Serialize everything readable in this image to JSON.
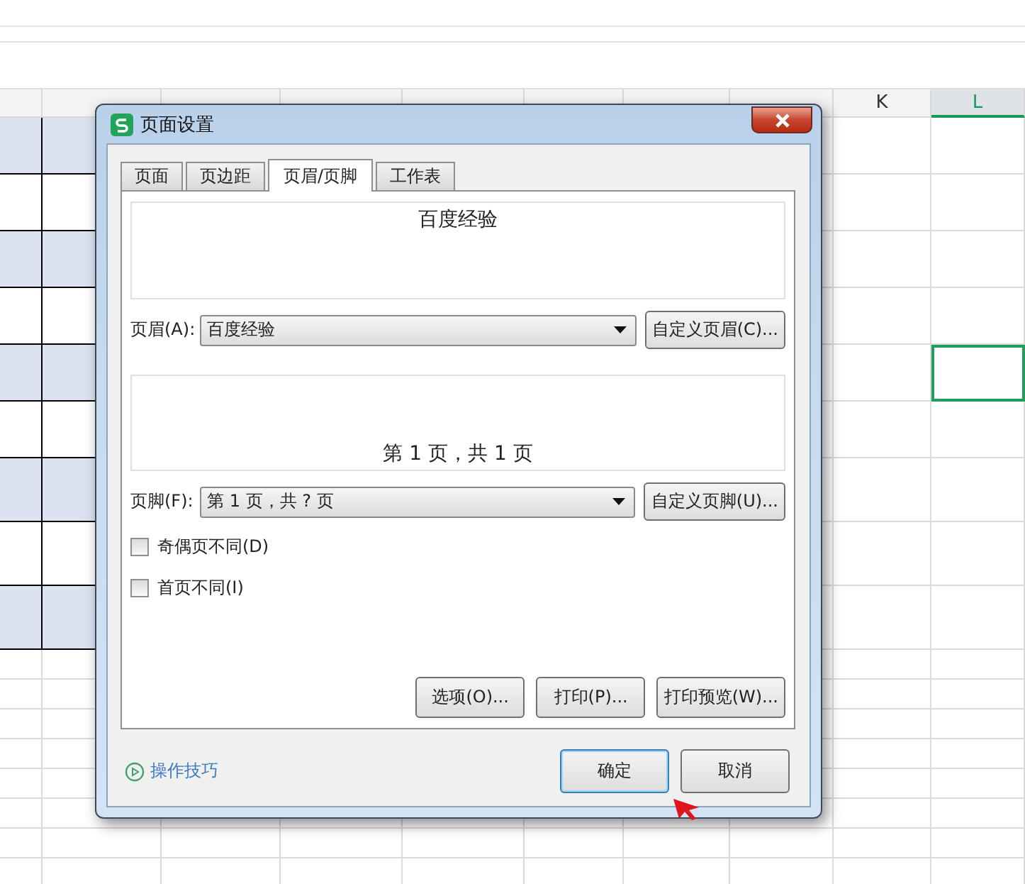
{
  "sheet": {
    "columns": [
      {
        "label": "K",
        "selected": false
      },
      {
        "label": "L",
        "selected": true
      }
    ]
  },
  "dialog": {
    "title": "页面设置",
    "tabs": [
      {
        "label": "页面",
        "selected": false
      },
      {
        "label": "页边距",
        "selected": false
      },
      {
        "label": "页眉/页脚",
        "selected": true
      },
      {
        "label": "工作表",
        "selected": false
      }
    ],
    "header_preview": "百度经验",
    "header": {
      "label": "页眉(A):",
      "value": "百度经验",
      "button": "自定义页眉(C)..."
    },
    "footer_preview": "第 1 页，共 1 页",
    "footer": {
      "label": "页脚(F):",
      "value": "第 1 页，共 ? 页",
      "button": "自定义页脚(U)..."
    },
    "checkboxes": [
      {
        "label": "奇偶页不同(D)",
        "checked": false
      },
      {
        "label": "首页不同(I)",
        "checked": false
      }
    ],
    "buttons": [
      "选项(O)...",
      "打印(P)...",
      "打印预览(W)..."
    ],
    "help_link": "操作技巧",
    "ok": "确定",
    "cancel": "取消"
  }
}
